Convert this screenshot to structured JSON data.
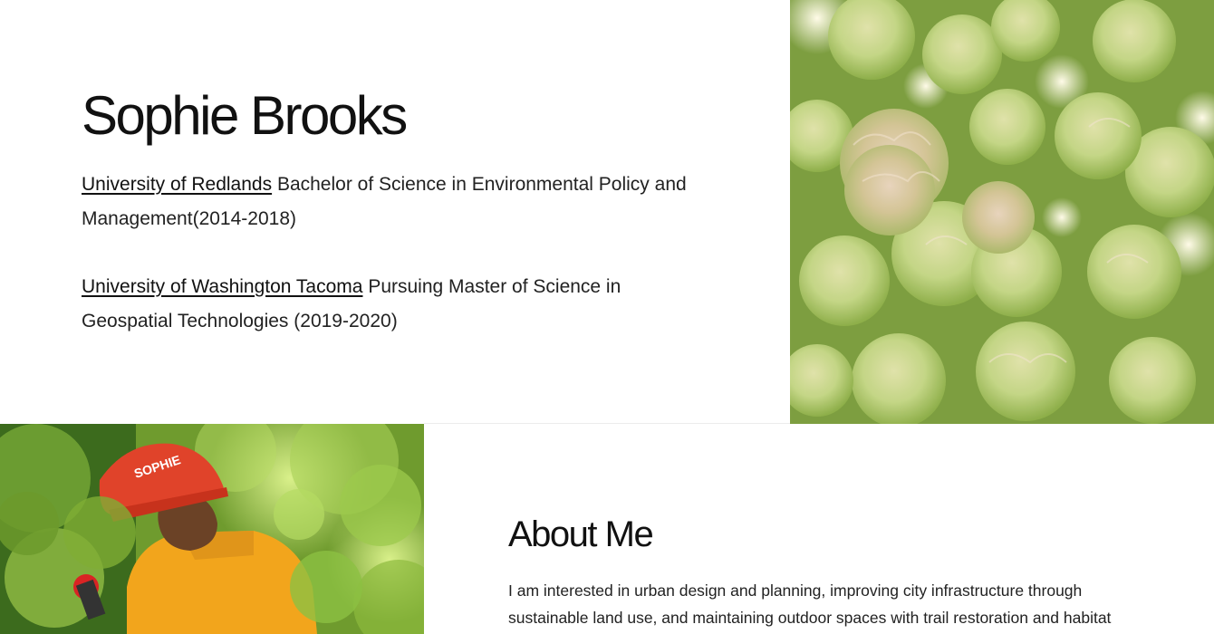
{
  "profile": {
    "name": "Sophie Brooks",
    "education": [
      {
        "school": "University of Redlands",
        "detail": "Bachelor of Science in Environmental Policy and Management(2014-2018)"
      },
      {
        "school": "University of Washington Tacoma",
        "detail": "Pursuing Master of Science in Geospatial Technologies (2019-2020)"
      }
    ]
  },
  "about": {
    "title": "About Me",
    "body": "I am interested in urban design and planning, improving city infrastructure through sustainable land use, and maintaining outdoor spaces with trail restoration and habitat"
  },
  "helmet_text": "SOPHIE",
  "colors": {
    "background": "#ffffff",
    "text": "#111111",
    "helmet": "#e0432a",
    "shirt": "#f2a51c",
    "foliage": "#8fbf3a",
    "flower": "#c9d98a"
  },
  "icons": {
    "flower_photo": "flower-photo-icon",
    "worker_photo": "trail-worker-photo-icon"
  }
}
